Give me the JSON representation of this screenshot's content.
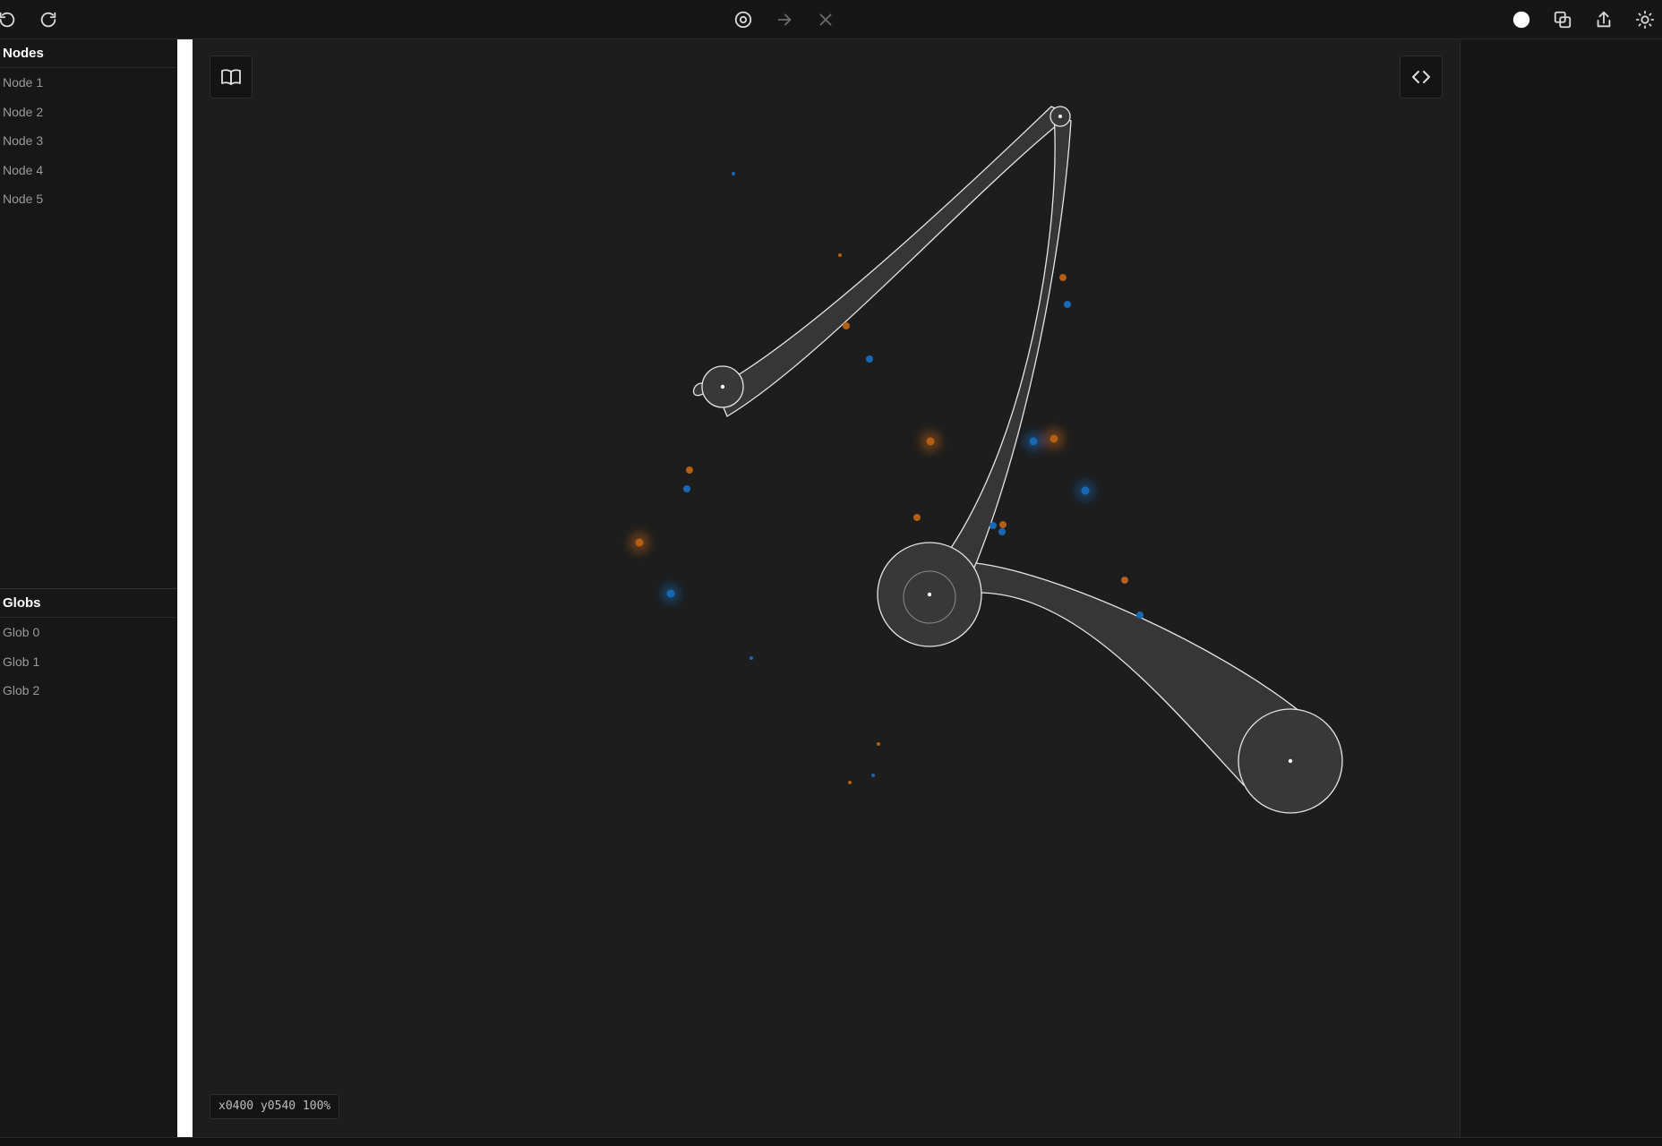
{
  "toolbar": {
    "left": [
      {
        "name": "undo-icon",
        "label": "Undo"
      },
      {
        "name": "redo-icon",
        "label": "Redo"
      }
    ],
    "center": [
      {
        "name": "target-icon",
        "label": "Focus"
      },
      {
        "name": "arrow-right-icon",
        "label": "Next"
      },
      {
        "name": "close-icon",
        "label": "Close"
      }
    ],
    "right": [
      {
        "name": "circle-icon",
        "label": "Color"
      },
      {
        "name": "copy-icon",
        "label": "Copy"
      },
      {
        "name": "share-icon",
        "label": "Share"
      },
      {
        "name": "sun-icon",
        "label": "Theme"
      }
    ]
  },
  "sidebar": {
    "nodes_header": "Nodes",
    "nodes": [
      "Node 1",
      "Node 2",
      "Node 3",
      "Node 4",
      "Node 5"
    ],
    "globs_header": "Globs",
    "globs": [
      "Glob 0",
      "Glob 1",
      "Glob 2"
    ]
  },
  "canvas": {
    "book_button_icon": "book-icon",
    "code_button_icon": "code-icon",
    "coords_readout": "x0400 y0540 100%"
  },
  "colors": {
    "orange": "#b35e12",
    "blue": "#1769b5",
    "glob_fill": "#383838",
    "glob_stroke": "#e6e6e6",
    "background": "#1d1d1d"
  }
}
